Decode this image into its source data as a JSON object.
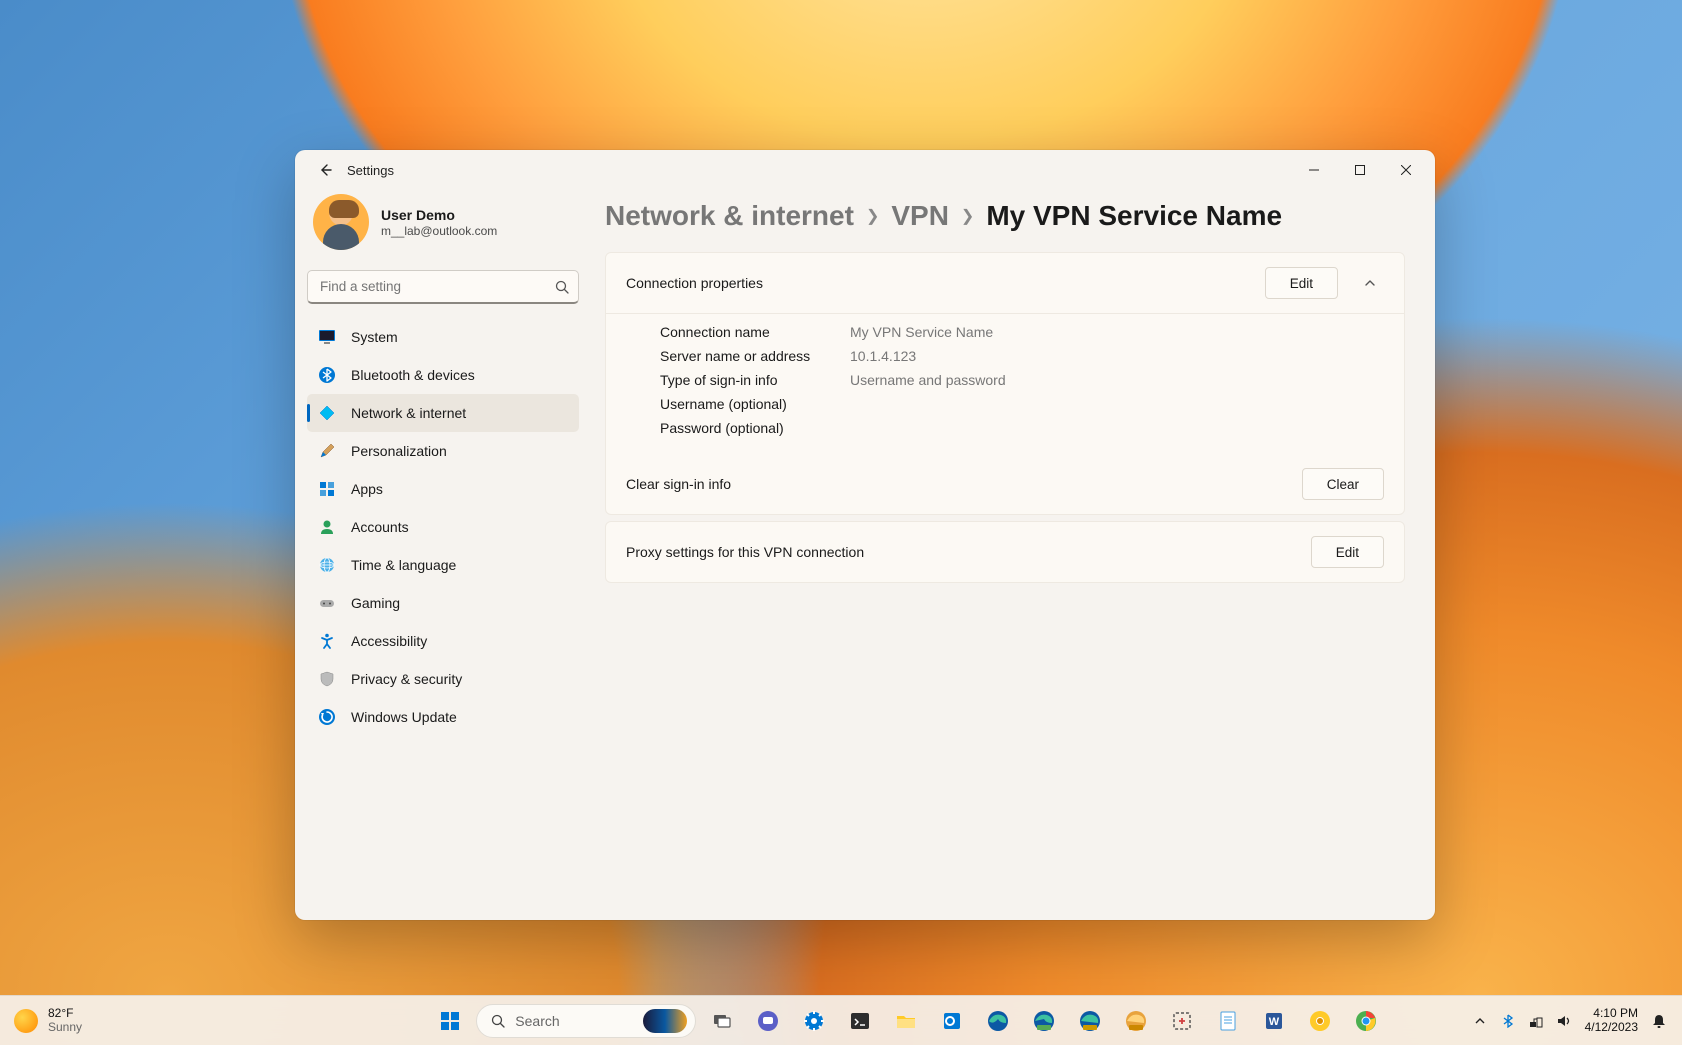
{
  "window": {
    "title": "Settings"
  },
  "profile": {
    "name": "User Demo",
    "email": "m__lab@outlook.com"
  },
  "search": {
    "placeholder": "Find a setting"
  },
  "sidebar": {
    "items": [
      {
        "icon": "💻",
        "label": "System"
      },
      {
        "icon": "bt",
        "label": "Bluetooth & devices"
      },
      {
        "icon": "💎",
        "label": "Network & internet"
      },
      {
        "icon": "🖌️",
        "label": "Personalization"
      },
      {
        "icon": "▦",
        "label": "Apps"
      },
      {
        "icon": "👤",
        "label": "Accounts"
      },
      {
        "icon": "🌐",
        "label": "Time & language"
      },
      {
        "icon": "🎮",
        "label": "Gaming"
      },
      {
        "icon": "♿",
        "label": "Accessibility"
      },
      {
        "icon": "🛡️",
        "label": "Privacy & security"
      },
      {
        "icon": "🔄",
        "label": "Windows Update"
      }
    ],
    "selected_index": 2
  },
  "breadcrumb": {
    "parts": [
      "Network & internet",
      "VPN",
      "My VPN Service Name"
    ]
  },
  "connection_properties": {
    "header": "Connection properties",
    "edit_label": "Edit",
    "rows": [
      {
        "k": "Connection name",
        "v": "My VPN Service Name"
      },
      {
        "k": "Server name or address",
        "v": "10.1.4.123"
      },
      {
        "k": "Type of sign-in info",
        "v": "Username and password"
      },
      {
        "k": "Username (optional)",
        "v": ""
      },
      {
        "k": "Password (optional)",
        "v": ""
      }
    ],
    "clear_label": "Clear sign-in info",
    "clear_button": "Clear"
  },
  "proxy": {
    "label": "Proxy settings for this VPN connection",
    "edit_label": "Edit"
  },
  "taskbar": {
    "weather": {
      "temp": "82°F",
      "cond": "Sunny"
    },
    "search_label": "Search",
    "clock": {
      "time": "4:10 PM",
      "date": "4/12/2023"
    }
  }
}
